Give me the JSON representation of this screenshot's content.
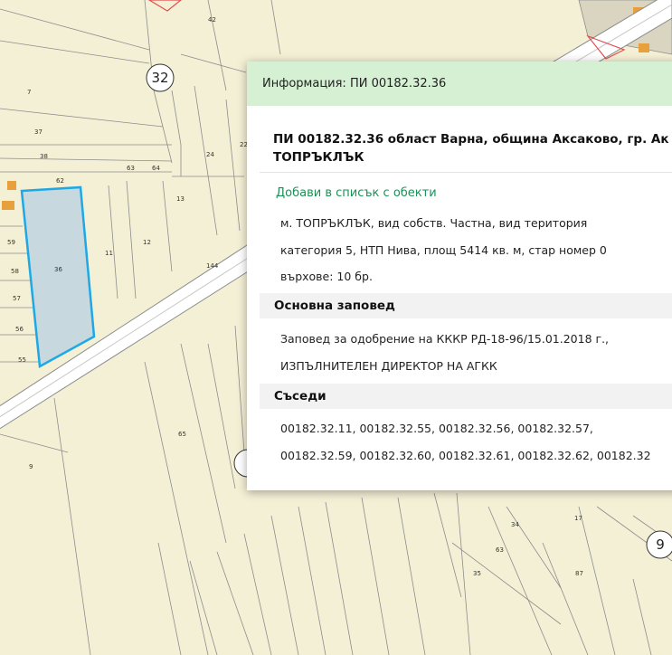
{
  "map": {
    "road_labels": [
      "32",
      "9"
    ],
    "parcel_labels": [
      "42",
      "7",
      "37",
      "38",
      "22",
      "24",
      "62",
      "63",
      "64",
      "13",
      "59",
      "12",
      "11",
      "58",
      "57",
      "56",
      "55",
      "9",
      "65",
      "34",
      "35",
      "17",
      "63",
      "36",
      "87",
      "144"
    ],
    "selected_parcel_label": "36",
    "colors": {
      "background": "#f4f0d6",
      "parcel_lines": "#8c8c8c",
      "selected_fill": "#c7d8df",
      "selected_border": "#1ea8e6",
      "road": "#ffffff",
      "building": "#e8a03c"
    }
  },
  "popup": {
    "header": "Информация: ПИ 00182.32.36",
    "title_line1": "ПИ 00182.32.36 област Варна, община Аксаково, гр. Ак",
    "title_line2": "ТОПРЪКЛЪК",
    "add_link": "Добави в списък с обекти",
    "details": [
      "м.  ТОПРЪКЛЪК,  вид  собств.  Частна,  вид  територия",
      "категория 5, НТП Нива, площ 5414 кв. м, стар номер 0",
      "върхове: 10 бр."
    ],
    "order_title": "Основна заповед",
    "order_lines": [
      "Заповед за одобрение на КККР РД-18-96/15.01.2018 г., ",
      "ИЗПЪЛНИТЕЛЕН ДИРЕКТОР НА АГКК"
    ],
    "neighbors_title": "Съседи",
    "neighbors_lines": [
      "00182.32.11,    00182.32.55,    00182.32.56,    00182.32.57,",
      "00182.32.59, 00182.32.60, 00182.32.61, 00182.32.62, 00182.32"
    ]
  }
}
